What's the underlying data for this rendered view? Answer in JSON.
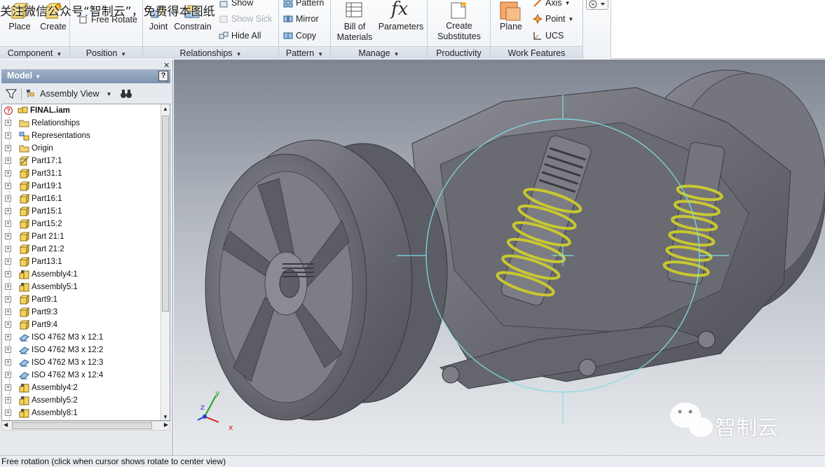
{
  "watermark": {
    "top_text": "关注微信公众号“智制云”，免费得本图纸",
    "bottom_text": "智制云"
  },
  "ribbon": {
    "panels": [
      {
        "title": "Component",
        "buttons": [
          "Place",
          "Create"
        ]
      },
      {
        "title": "Position",
        "buttons": [
          "Free Rotate"
        ]
      },
      {
        "title": "Relationships",
        "buttons": [
          "Joint",
          "Constrain",
          "Show",
          "Show Sick",
          "Hide All"
        ]
      },
      {
        "title": "Pattern",
        "buttons": [
          "Pattern",
          "Mirror",
          "Copy"
        ]
      },
      {
        "title": "Manage",
        "buttons": [
          "Bill of Materials",
          "Parameters"
        ]
      },
      {
        "title": "Productivity",
        "buttons": [
          "Create Substitutes"
        ]
      },
      {
        "title": "Work Features",
        "buttons": [
          "Plane",
          "Axis",
          "Point",
          "UCS"
        ]
      }
    ],
    "bom_line1": "Bill of",
    "bom_line2": "Materials",
    "subs_line1": "Create",
    "subs_line2": "Substitutes",
    "fx_glyph": "fx"
  },
  "browser": {
    "title": "Model",
    "help": "?",
    "view_selector": "Assembly View",
    "tree": [
      {
        "label": "FINAL.iam",
        "icon": "assembly-root-icon",
        "root": true
      },
      {
        "label": "Relationships",
        "icon": "folder-icon"
      },
      {
        "label": "Representations",
        "icon": "representations-icon"
      },
      {
        "label": "Origin",
        "icon": "folder-icon"
      },
      {
        "label": "Part17:1",
        "icon": "part-flexible-icon"
      },
      {
        "label": "Part31:1",
        "icon": "part-icon"
      },
      {
        "label": "Part19:1",
        "icon": "part-icon"
      },
      {
        "label": "Part16:1",
        "icon": "part-icon"
      },
      {
        "label": "Part15:1",
        "icon": "part-icon"
      },
      {
        "label": "Part15:2",
        "icon": "part-icon"
      },
      {
        "label": "Part 21:1",
        "icon": "part-icon"
      },
      {
        "label": "Part 21:2",
        "icon": "part-icon"
      },
      {
        "label": "Part13:1",
        "icon": "part-icon"
      },
      {
        "label": "Assembly4:1",
        "icon": "assembly-icon"
      },
      {
        "label": "Assembly5:1",
        "icon": "assembly-icon"
      },
      {
        "label": "Part9:1",
        "icon": "part-icon"
      },
      {
        "label": "Part9:3",
        "icon": "part-icon"
      },
      {
        "label": "Part9:4",
        "icon": "part-icon"
      },
      {
        "label": "ISO 4762 M3 x 12:1",
        "icon": "content-center-part-icon"
      },
      {
        "label": "ISO 4762 M3 x 12:2",
        "icon": "content-center-part-icon"
      },
      {
        "label": "ISO 4762 M3 x 12:3",
        "icon": "content-center-part-icon"
      },
      {
        "label": "ISO 4762 M3 x 12:4",
        "icon": "content-center-part-icon"
      },
      {
        "label": "Assembly4:2",
        "icon": "assembly-icon"
      },
      {
        "label": "Assembly5:2",
        "icon": "assembly-icon"
      },
      {
        "label": "Assembly8:1",
        "icon": "assembly-icon"
      }
    ]
  },
  "viewport": {
    "triad_labels": [
      "x",
      "y",
      "z"
    ]
  },
  "status_bar": {
    "text": "Free rotation (click when cursor shows rotate to center view)"
  },
  "colors": {
    "spring": "#c8c830",
    "model_body": "#6e6e76",
    "rotate_circle": "#7fe0e8",
    "model_header": "#8aa0bc"
  }
}
